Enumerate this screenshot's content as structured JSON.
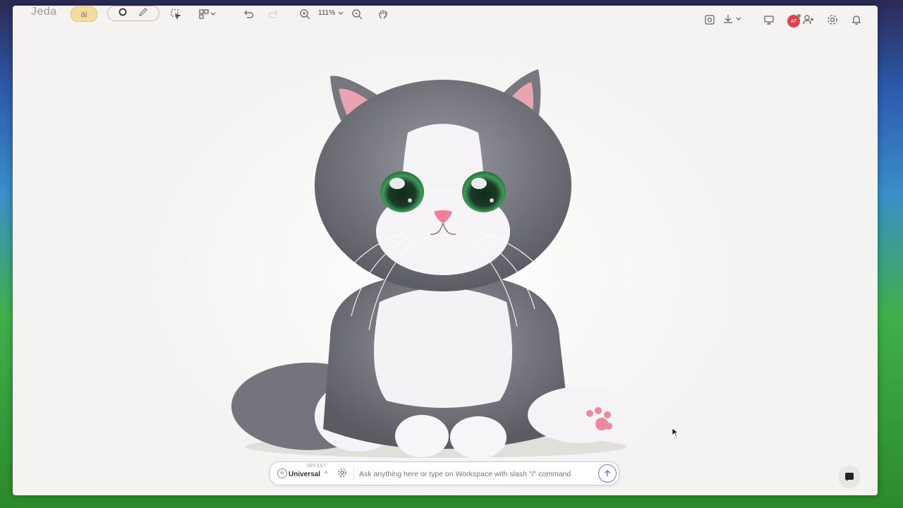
{
  "app": {
    "logo": "Jeda",
    "ai_badge": "ai"
  },
  "toolbar": {
    "zoom_level": "111%",
    "icons": [
      "ai-icon",
      "circle-tool-icon",
      "pen-tool-icon",
      "select-icon",
      "layout-icon",
      "undo-icon",
      "redo-icon",
      "zoom-in-icon",
      "zoom-out-icon",
      "hand-icon",
      "image-search-icon",
      "download-icon",
      "present-icon",
      "add-user-icon",
      "settings-icon",
      "bell-icon"
    ]
  },
  "user": {
    "initials": "AT",
    "avatar_color": "#e0404f",
    "status_color": "#40b040"
  },
  "chat": {
    "model_badge": "AI",
    "model_tag": "GPT-3.5 T",
    "model_name": "Universal",
    "placeholder": "Ask anything here or type on Workspace with slash \"/\" command"
  },
  "canvas": {
    "image": "kitten-illustration",
    "accent_color": "#6a78d6"
  }
}
